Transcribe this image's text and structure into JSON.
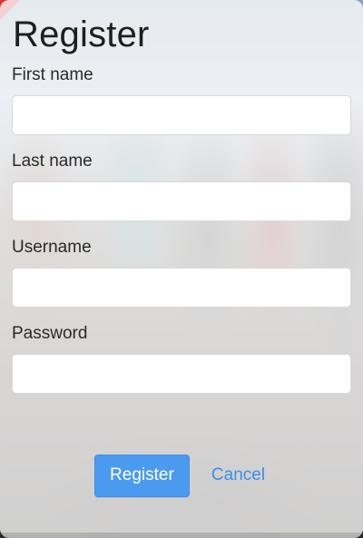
{
  "form": {
    "title": "Register",
    "fields": [
      {
        "label": "First name",
        "value": "",
        "placeholder": ""
      },
      {
        "label": "Last name",
        "value": "",
        "placeholder": ""
      },
      {
        "label": "Username",
        "value": "",
        "placeholder": ""
      },
      {
        "label": "Password",
        "value": "",
        "placeholder": ""
      }
    ],
    "actions": {
      "register_label": "Register",
      "cancel_label": "Cancel"
    }
  },
  "colors": {
    "primary_button": "#4a9bf0",
    "link": "#3a8fe8",
    "accent_corner": "#e02b2b"
  }
}
